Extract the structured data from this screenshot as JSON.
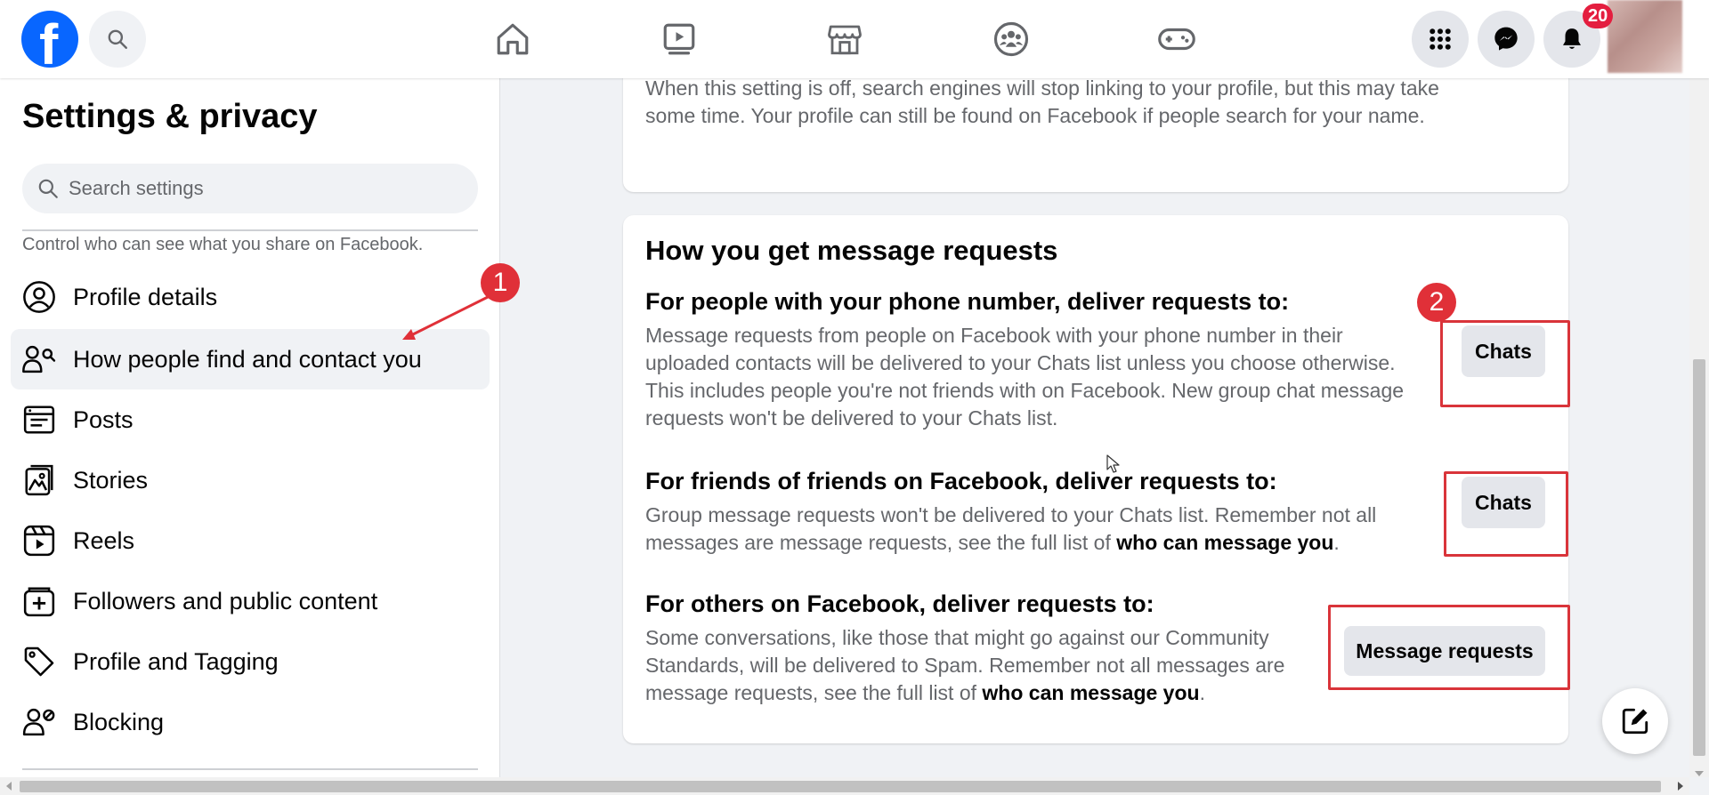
{
  "topbar": {
    "logo_letter": "f",
    "notifications_count": "20"
  },
  "sidebar": {
    "title": "Settings & privacy",
    "search_placeholder": "Search settings",
    "description": "Control who can see what you share on Facebook.",
    "items": [
      {
        "label": "Profile details",
        "icon": "person-icon"
      },
      {
        "label": "How people find and contact you",
        "icon": "people-search-icon",
        "active": true
      },
      {
        "label": "Posts",
        "icon": "posts-icon"
      },
      {
        "label": "Stories",
        "icon": "stories-icon"
      },
      {
        "label": "Reels",
        "icon": "reels-icon"
      },
      {
        "label": "Followers and public content",
        "icon": "followers-icon"
      },
      {
        "label": "Profile and Tagging",
        "icon": "tag-icon"
      },
      {
        "label": "Blocking",
        "icon": "block-user-icon"
      }
    ]
  },
  "main": {
    "search_engine_text": "When this setting is off, search engines will stop linking to your profile, but this may take some time. Your profile can still be found on Facebook if people search for your name.",
    "message_requests": {
      "heading": "How you get message requests",
      "sections": [
        {
          "title": "For people with your phone number, deliver requests to:",
          "description": "Message requests from people on Facebook with your phone number in their uploaded contacts will be delivered to your Chats list unless you choose otherwise. This includes people you're not friends with on Facebook. New group chat message requests won't be delivered to your Chats list.",
          "button": "Chats"
        },
        {
          "title": "For friends of friends on Facebook, deliver requests to:",
          "description": "Group message requests won't be delivered to your Chats list. Remember not all messages are message requests, see the full list of ",
          "link": "who can message you",
          "suffix": ".",
          "button": "Chats"
        },
        {
          "title": "For others on Facebook, deliver requests to:",
          "description": "Some conversations, like those that might go against our Community Standards, will be delivered to Spam. Remember not all messages are message requests, see the full list of ",
          "link": "who can message you",
          "suffix": ".",
          "button": "Message requests"
        }
      ]
    }
  },
  "annotations": {
    "marker_1": "1",
    "marker_2": "2",
    "color": "#d9343a"
  },
  "colors": {
    "brand": "#0866ff",
    "badge": "#e41e3f"
  }
}
